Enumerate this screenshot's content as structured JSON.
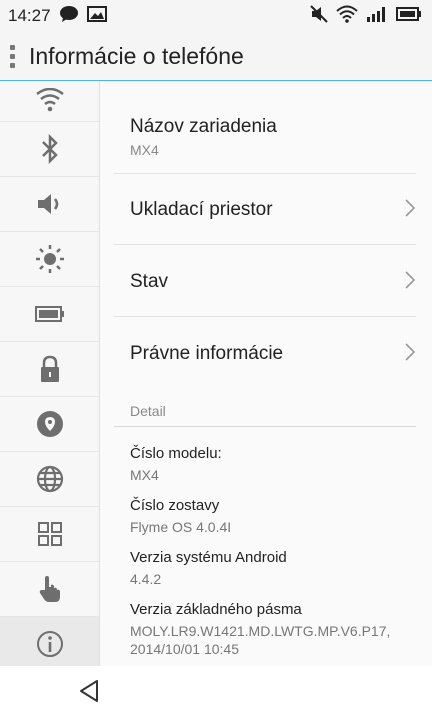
{
  "status_bar": {
    "time": "14:27",
    "left_icons": [
      "chat-bubble-icon",
      "image-icon"
    ],
    "right_icons": [
      "mute-icon",
      "wifi-icon",
      "signal-icon",
      "battery-icon"
    ]
  },
  "header": {
    "title": "Informácie o telefóne"
  },
  "sidebar": {
    "items": [
      {
        "icon": "wifi-icon"
      },
      {
        "icon": "bluetooth-icon"
      },
      {
        "icon": "volume-icon"
      },
      {
        "icon": "brightness-icon"
      },
      {
        "icon": "battery-icon"
      },
      {
        "icon": "lock-icon"
      },
      {
        "icon": "location-icon"
      },
      {
        "icon": "globe-icon"
      },
      {
        "icon": "apps-grid-icon"
      },
      {
        "icon": "touch-icon"
      },
      {
        "icon": "info-icon",
        "active": true
      }
    ]
  },
  "main": {
    "device_name": {
      "label": "Názov zariadenia",
      "value": "MX4"
    },
    "storage": {
      "label": "Ukladací priestor"
    },
    "status": {
      "label": "Stav"
    },
    "legal": {
      "label": "Právne informácie"
    },
    "section_title": "Detail",
    "details": [
      {
        "key": "Číslo modelu:",
        "value": "MX4"
      },
      {
        "key": "Číslo zostavy",
        "value": "Flyme OS 4.0.4I"
      },
      {
        "key": "Verzia systému Android",
        "value": "4.4.2"
      },
      {
        "key": "Verzia základného pásma",
        "value": "MOLY.LR9.W1421.MD.LWTG.MP.V6.P17,",
        "value2": "2014/10/01 10:45"
      }
    ]
  },
  "nav_bar": {
    "back_icon": "back-triangle-icon"
  },
  "colors": {
    "accent_line": "#50b0f0",
    "icon_gray": "#6e6e6e"
  }
}
